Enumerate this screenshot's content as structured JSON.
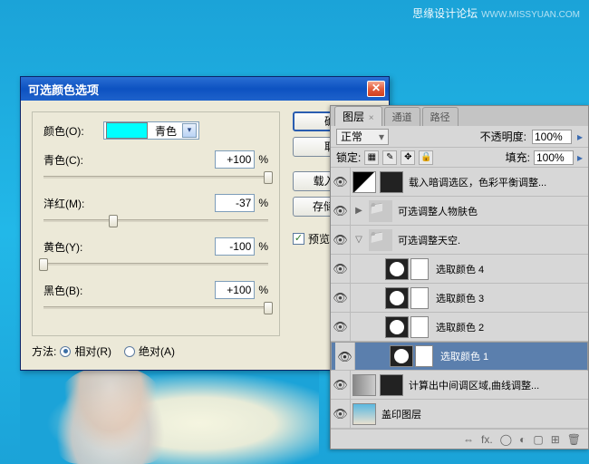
{
  "watermark": {
    "main": "思缘设计论坛",
    "sub": "WWW.MISSYUAN.COM"
  },
  "dialog": {
    "title": "可选颜色选项",
    "color_label": "颜色(O):",
    "color_name": "青色",
    "sliders": [
      {
        "label": "青色(C):",
        "value": "+100",
        "pos": 100
      },
      {
        "label": "洋红(M):",
        "value": "-37",
        "pos": 31
      },
      {
        "label": "黄色(Y):",
        "value": "-100",
        "pos": 0
      },
      {
        "label": "黑色(B):",
        "value": "+100",
        "pos": 100
      }
    ],
    "pct": "%",
    "method_label": "方法:",
    "method_relative": "相对(R)",
    "method_absolute": "绝对(A)",
    "buttons": {
      "ok": "确定",
      "cancel": "取消",
      "load": "载入(L)...",
      "save": "存储(S)..."
    },
    "preview": "预览(P)"
  },
  "panel": {
    "tabs": {
      "layers": "图层",
      "channels": "通道",
      "paths": "路径"
    },
    "blend": "正常",
    "opacity_label": "不透明度:",
    "opacity_val": "100%",
    "lock_label": "锁定:",
    "fill_label": "填充:",
    "fill_val": "100%",
    "layers": [
      {
        "name": "载入暗调选区，色彩平衡调整...",
        "type": "adj"
      },
      {
        "name": "可选调整人物肤色",
        "type": "group-closed"
      },
      {
        "name": "可选调整天空.",
        "type": "group-open"
      },
      {
        "name": "选取颜色 4",
        "type": "sel"
      },
      {
        "name": "选取颜色 3",
        "type": "sel"
      },
      {
        "name": "选取颜色 2",
        "type": "sel"
      },
      {
        "name": "选取颜色 1",
        "type": "sel",
        "selected": true
      },
      {
        "name": "计算出中间调区域,曲线调整...",
        "type": "adj2"
      },
      {
        "name": "盖印图层",
        "type": "img"
      }
    ],
    "footer": [
      "⇔",
      "fx.",
      "◯",
      "◐",
      "▢",
      "⊞",
      "🗑"
    ]
  }
}
